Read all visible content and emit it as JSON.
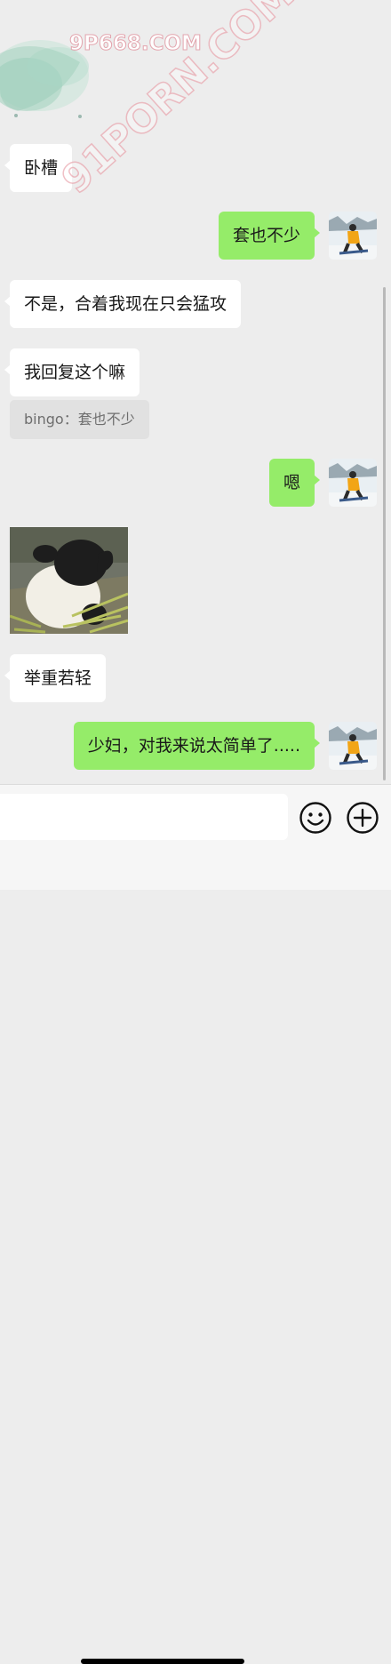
{
  "watermark": {
    "top": "9P668.COM",
    "diagonal": "91PORN.COM"
  },
  "messages": [
    {
      "side": "left",
      "text": "卧槽"
    },
    {
      "side": "right",
      "text": "套也不少"
    },
    {
      "side": "left",
      "text": "不是，合着我现在只会猛攻"
    },
    {
      "side": "left",
      "text": "我回复这个嘛",
      "quote": "bingo：套也不少"
    },
    {
      "side": "right",
      "text": "嗯"
    },
    {
      "side": "left",
      "image": "panda-sticker"
    },
    {
      "side": "left",
      "text": "举重若轻"
    },
    {
      "side": "right",
      "text": "少妇，对我来说太简单了....."
    }
  ],
  "input_bar": {
    "emoji_icon": "smiley-icon",
    "more_icon": "plus-circle-icon"
  },
  "colors": {
    "chat_bg": "#ededed",
    "self_bubble": "#95ec69",
    "other_bubble": "#ffffff",
    "quote_bg": "#e1e1e1"
  }
}
